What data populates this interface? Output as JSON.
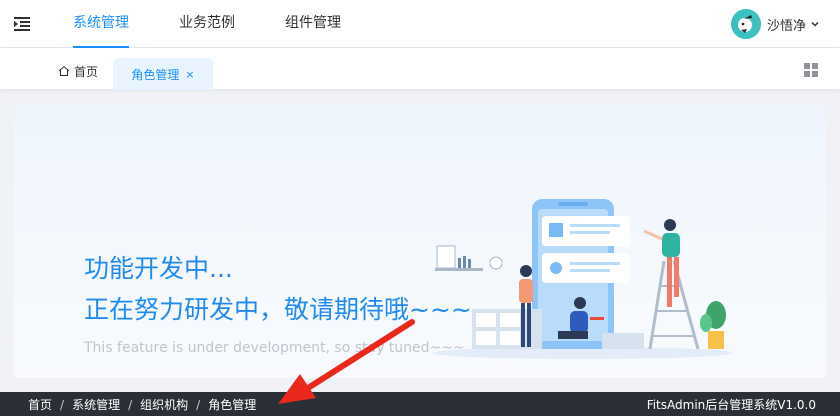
{
  "header": {
    "tabs": [
      {
        "label": "系统管理",
        "active": true
      },
      {
        "label": "业务范例",
        "active": false
      },
      {
        "label": "组件管理",
        "active": false
      }
    ],
    "user": {
      "name": "沙悟净",
      "avatar_icon": "avatar-icon"
    }
  },
  "tabs_bar": {
    "home_label": "首页",
    "open_tab": {
      "label": "角色管理",
      "close_symbol": "×"
    }
  },
  "main": {
    "title_line1": "功能开发中...",
    "title_line2": "正在努力研发中，敬请期待哦~~~",
    "subtitle": "This feature is under development, so stay tuned~~~"
  },
  "footer": {
    "breadcrumbs": [
      "首页",
      "系统管理",
      "组织机构",
      "角色管理"
    ],
    "separator": "/",
    "app_version": "FitsAdmin后台管理系统V1.0.0"
  },
  "colors": {
    "accent": "#1890ff",
    "footer_bg": "#2b2f36",
    "annotation_arrow": "#e8291c"
  }
}
